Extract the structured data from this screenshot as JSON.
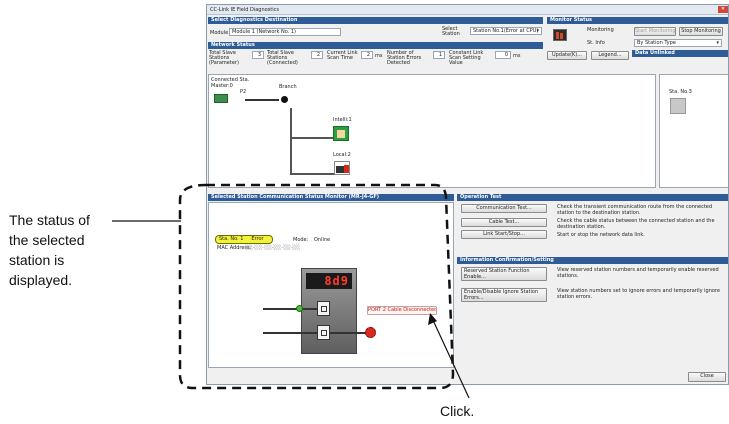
{
  "window": {
    "title": "CC-Link IE Field Diagnostics",
    "close_glyph": "✕"
  },
  "select_destination": {
    "header": "Select Diagnostics Destination",
    "module_label": "Module",
    "module_value": "Module 1 (Network No. 1)",
    "select_station_label": "Select Station",
    "select_station_value": "Station No.1(Error at CPU)"
  },
  "monitor_status": {
    "header": "Monitor Status",
    "monitoring_text": "Monitoring",
    "start_button": "Start Monitoring",
    "stop_button": "Stop Monitoring",
    "st_info_label": "St. Info",
    "by_station_type": "By Station Type",
    "data_unlinked": "Data Unlinked"
  },
  "network_status": {
    "header": "Network Status",
    "total_slave_param_label": "Total Slave Stations (Parameter)",
    "total_slave_param_value": "3",
    "total_slave_conn_label": "Total Slave Stations (Connected)",
    "total_slave_conn_value": "2",
    "link_scan_label": "Current Link Scan Time",
    "link_scan_value": "2",
    "link_scan_unit": "ms",
    "errors_label": "Number of Station Errors Detected",
    "errors_value": "1",
    "constant_scan_label": "Constant Link Scan Setting Value",
    "constant_scan_value": "0",
    "constant_scan_unit": "ms",
    "update_button": "Update(K)...",
    "legend_button": "Legend..."
  },
  "topology": {
    "connected_sta": "Connected Sta.",
    "master": "Master:0",
    "p2": "P2",
    "branch": "Branch",
    "intelli": "Intelli:1",
    "local": "Local:2",
    "sta_no3": "Sta. No.3"
  },
  "station_monitor": {
    "header": "Selected Station Communication Status Monitor (MR-J4-GF)",
    "sta_badge": "Sta. No. 1     Error",
    "mode_label": "Mode:",
    "mode_value": "Online",
    "mac_label": "MAC Address:",
    "mac_value": "░░-░░-░░-░░-░░-░░",
    "seg_display": "8d9",
    "port2_button": "PORT 2 Cable Disconnected..."
  },
  "operation_test": {
    "header": "Operation Test",
    "items": [
      {
        "button": "Communication Test...",
        "desc": "Check the transient communication route from the connected station to the destination station."
      },
      {
        "button": "Cable Test...",
        "desc": "Check the cable status between the connected station and the destination station."
      },
      {
        "button": "Link Start/Stop...",
        "desc": "Start or stop the network data link."
      }
    ]
  },
  "info_setting": {
    "header": "Information Confirmation/Setting",
    "items": [
      {
        "button": "Reserved Station Function Enable...",
        "desc": "View reserved station numbers and temporarily enable reserved stations."
      },
      {
        "button": "Enable/Disable Ignore Station Errors...",
        "desc": "View station numbers set to ignore errors and temporarily ignore station errors."
      }
    ]
  },
  "footer": {
    "close_button": "Close"
  },
  "annotations": {
    "status_callout": [
      "The status of",
      "the selected",
      "station is",
      "displayed."
    ],
    "click_label": "Click."
  },
  "colors": {
    "header_blue": "#2d5c96",
    "error_yellow": "#f2f23a",
    "error_red": "#d8291f",
    "disp_red": "#ff3b2a"
  }
}
